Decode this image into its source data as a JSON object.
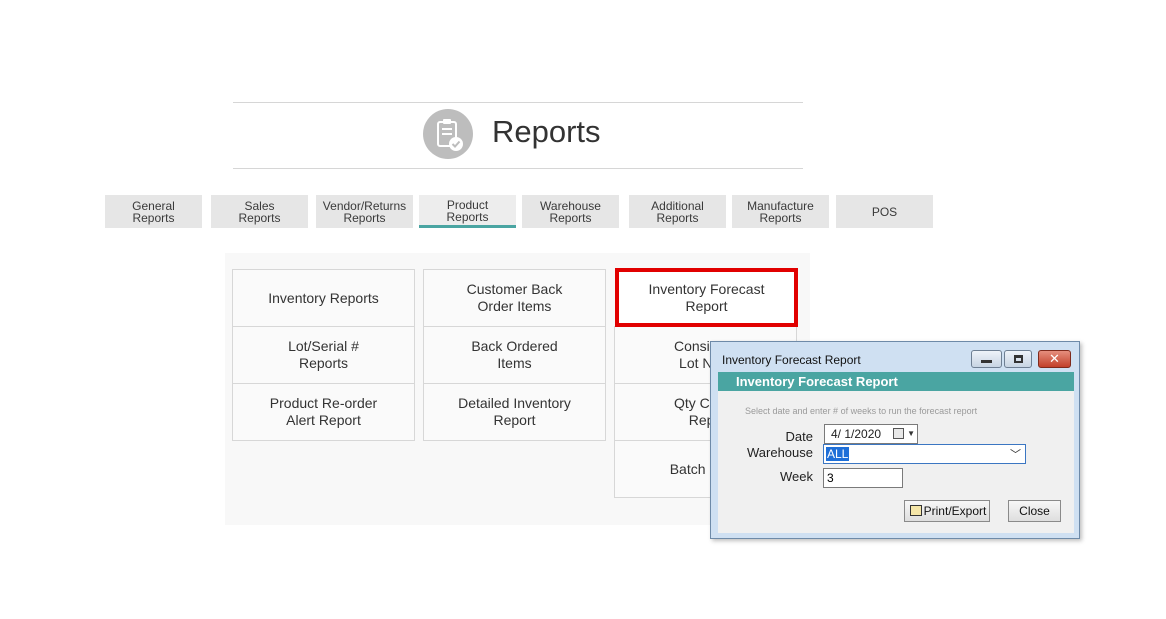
{
  "page": {
    "title": "Reports",
    "icon": "clipboard-check-icon"
  },
  "tabs": [
    {
      "label": "General\nReports"
    },
    {
      "label": "Sales\nReports"
    },
    {
      "label": "Vendor/Returns\nReports"
    },
    {
      "label": "Product\nReports",
      "active": true
    },
    {
      "label": "Warehouse\nReports"
    },
    {
      "label": "Additional\nReports"
    },
    {
      "label": "Manufacture\nReports"
    },
    {
      "label": "POS"
    }
  ],
  "cards": {
    "col1": [
      "Inventory Reports",
      "Lot/Serial #\nReports",
      "Product Re-order\nAlert Report"
    ],
    "col2": [
      "Customer Back\nOrder Items",
      "Back Ordered\nItems",
      "Detailed  Inventory\nReport"
    ],
    "col3": [
      "Inventory Forecast\nReport",
      "Consignm\nLot Num",
      "Qty Comp\nRepo",
      "Batch Histo"
    ]
  },
  "dialog": {
    "window_title": "Inventory Forecast Report",
    "header": "Inventory Forecast Report",
    "hint": "Select date and enter # of weeks to run the forecast report",
    "date_label": "Date",
    "date_value": "4/  1/2020",
    "warehouse_label": "Warehouse",
    "warehouse_value": "ALL",
    "week_label": "Week",
    "week_value": "3",
    "print_button": "Print/Export",
    "close_button": "Close"
  },
  "colors": {
    "accent": "#4aa5a2",
    "highlight": "#e10000"
  }
}
